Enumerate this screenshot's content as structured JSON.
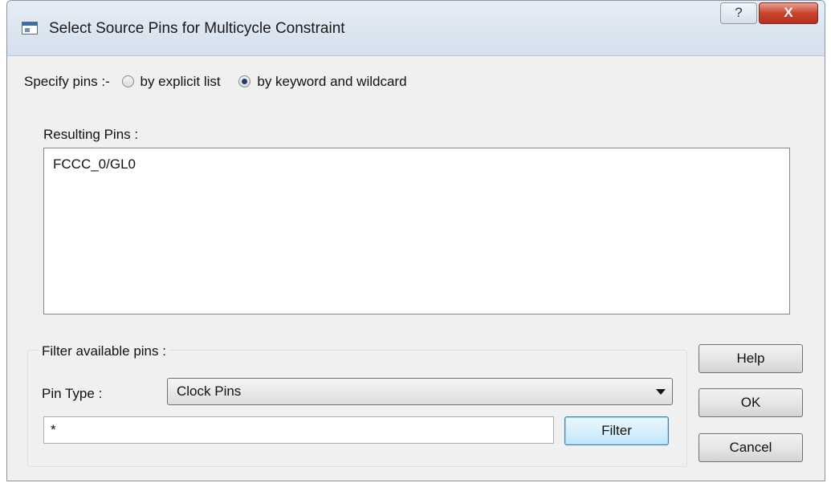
{
  "window": {
    "title": "Select Source Pins for Multicycle Constraint",
    "help_glyph": "?",
    "close_glyph": "X"
  },
  "specify": {
    "label": "Specify pins :-",
    "options": [
      {
        "label": "by explicit list",
        "selected": false
      },
      {
        "label": "by keyword and wildcard",
        "selected": true
      }
    ]
  },
  "resulting": {
    "label": "Resulting Pins :",
    "pins": [
      "FCCC_0/GL0"
    ]
  },
  "filter": {
    "group_label": "Filter available pins :",
    "pin_type_label": "Pin Type :",
    "pin_type_value": "Clock Pins",
    "pattern_value": "*",
    "filter_button": "Filter"
  },
  "buttons": {
    "help": "Help",
    "ok": "OK",
    "cancel": "Cancel"
  },
  "icons": {
    "app": "dialog-window-icon",
    "help": "question-mark-icon",
    "close": "close-x-icon",
    "dropdown": "chevron-down-icon"
  },
  "colors": {
    "close_button": "#c8442d",
    "focused_button": "#3c7fb1",
    "dialog_background": "#f0f0f0"
  }
}
